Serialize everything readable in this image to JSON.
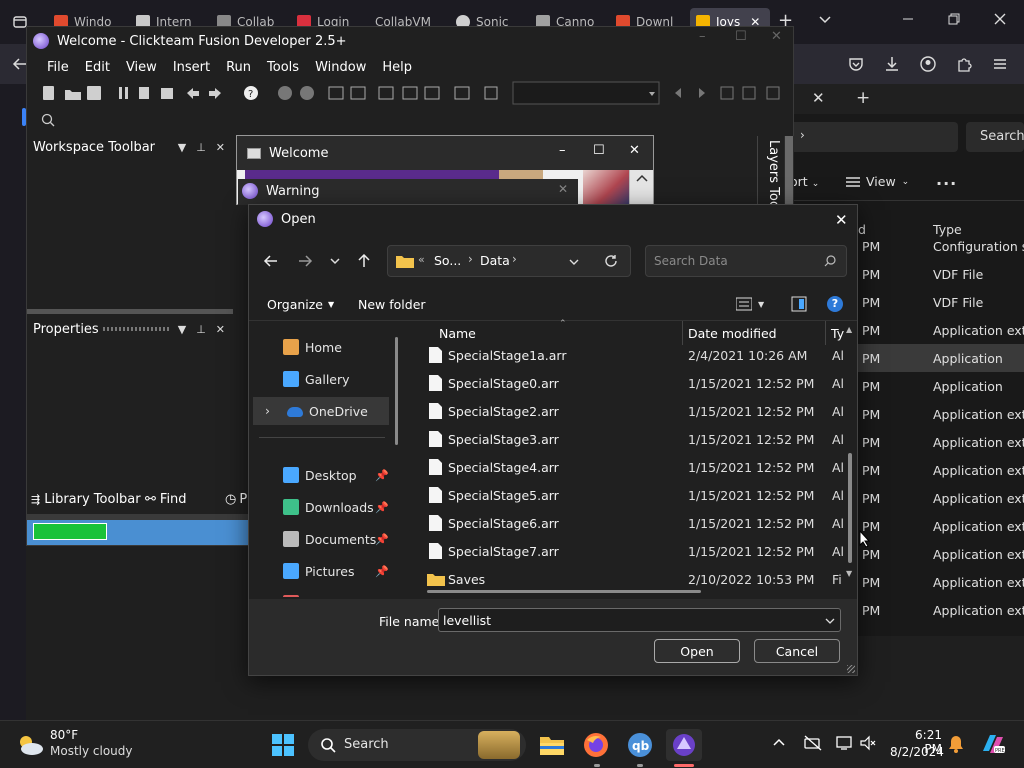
{
  "browser": {
    "tabs": [
      {
        "label": "Windo",
        "color": "#e04a2e"
      },
      {
        "label": "Intern",
        "color": "#c8c8c8"
      },
      {
        "label": "Collab",
        "color": "#888888"
      },
      {
        "label": "Login",
        "color": "#d9303e"
      },
      {
        "label": "CollabVM",
        "color": ""
      },
      {
        "label": "Sonic",
        "color": "#cfcfcf"
      },
      {
        "label": "Canno",
        "color": "#a0a0a0"
      },
      {
        "label": "Downl",
        "color": "#e04a2e"
      },
      {
        "label": "Joys",
        "color": "#f5b400"
      }
    ],
    "new_tab": "+"
  },
  "explorer": {
    "search_label": "Search",
    "sort_label": "ort",
    "view_label": "View",
    "more": "...",
    "col_time": "d",
    "col_type": "Type",
    "rows": [
      {
        "time": "PM",
        "type": "Configuration set",
        "selected": false
      },
      {
        "time": "PM",
        "type": "VDF File",
        "selected": false
      },
      {
        "time": "PM",
        "type": "VDF File",
        "selected": false
      },
      {
        "time": "PM",
        "type": "Application exten",
        "selected": false
      },
      {
        "time": "PM",
        "type": "Application",
        "selected": true
      },
      {
        "time": "PM",
        "type": "Application",
        "selected": false
      },
      {
        "time": "PM",
        "type": "Application exten",
        "selected": false
      },
      {
        "time": "PM",
        "type": "Application exten",
        "selected": false
      },
      {
        "time": "PM",
        "type": "Application exten",
        "selected": false
      },
      {
        "time": "PM",
        "type": "Application exten",
        "selected": false
      },
      {
        "time": "PM",
        "type": "Application exten",
        "selected": false
      },
      {
        "time": "PM",
        "type": "Application exten",
        "selected": false
      },
      {
        "time": "PM",
        "type": "Application exten",
        "selected": false
      },
      {
        "time": "PM",
        "type": "Application exten",
        "selected": false
      }
    ]
  },
  "fusion": {
    "title": "Welcome - Clickteam Fusion Developer 2.5+",
    "menu": [
      "File",
      "Edit",
      "View",
      "Insert",
      "Run",
      "Tools",
      "Window",
      "Help"
    ],
    "workspace_toolbar": "Workspace Toolbar",
    "properties": "Properties",
    "library_toolbar": "Library Toolbar",
    "find": "Find",
    "p_tab": "P",
    "layers_toolbar": "Layers Toolb",
    "welcome_title": "Welcome",
    "warning_title": "Warning"
  },
  "dialog": {
    "title": "Open",
    "breadcrumb": {
      "prefix": "«",
      "parent": "So...",
      "current": "Data"
    },
    "search_placeholder": "Search Data",
    "organize": "Organize",
    "new_folder": "New folder",
    "columns": {
      "name": "Name",
      "date": "Date modified",
      "type": "Ty"
    },
    "nav": [
      {
        "label": "Home",
        "icon": "home-icon",
        "pinned": false,
        "expandable": false,
        "selected": false
      },
      {
        "label": "Gallery",
        "icon": "gallery-icon",
        "pinned": false,
        "expandable": false,
        "selected": false
      },
      {
        "label": "OneDrive",
        "icon": "onedrive-icon",
        "pinned": false,
        "expandable": true,
        "selected": true
      },
      {
        "label": "Desktop",
        "icon": "desktop-icon",
        "pinned": true,
        "expandable": false,
        "selected": false
      },
      {
        "label": "Downloads",
        "icon": "downloads-icon",
        "pinned": true,
        "expandable": false,
        "selected": false
      },
      {
        "label": "Documents",
        "icon": "documents-icon",
        "pinned": true,
        "expandable": false,
        "selected": false
      },
      {
        "label": "Pictures",
        "icon": "pictures-icon",
        "pinned": true,
        "expandable": false,
        "selected": false
      },
      {
        "label": "Music",
        "icon": "music-icon",
        "pinned": false,
        "expandable": false,
        "selected": false
      }
    ],
    "files": [
      {
        "name": "SpecialStage1a.arr",
        "date": "2/4/2021 10:26 AM",
        "type": "Al",
        "kind": "file"
      },
      {
        "name": "SpecialStage0.arr",
        "date": "1/15/2021 12:52 PM",
        "type": "Al",
        "kind": "file"
      },
      {
        "name": "SpecialStage2.arr",
        "date": "1/15/2021 12:52 PM",
        "type": "Al",
        "kind": "file"
      },
      {
        "name": "SpecialStage3.arr",
        "date": "1/15/2021 12:52 PM",
        "type": "Al",
        "kind": "file"
      },
      {
        "name": "SpecialStage4.arr",
        "date": "1/15/2021 12:52 PM",
        "type": "Al",
        "kind": "file"
      },
      {
        "name": "SpecialStage5.arr",
        "date": "1/15/2021 12:52 PM",
        "type": "Al",
        "kind": "file"
      },
      {
        "name": "SpecialStage6.arr",
        "date": "1/15/2021 12:52 PM",
        "type": "Al",
        "kind": "file"
      },
      {
        "name": "SpecialStage7.arr",
        "date": "1/15/2021 12:52 PM",
        "type": "Al",
        "kind": "file"
      },
      {
        "name": "Saves",
        "date": "2/10/2022 10:53 PM",
        "type": "Fi",
        "kind": "folder"
      }
    ],
    "file_name_label": "File name:",
    "file_name_value": "levellist",
    "open_button": "Open",
    "cancel_button": "Cancel"
  },
  "taskbar": {
    "weather_temp": "80°F",
    "weather_desc": "Mostly cloudy",
    "search": "Search",
    "time": "6:21 PM",
    "date": "8/2/2024"
  }
}
